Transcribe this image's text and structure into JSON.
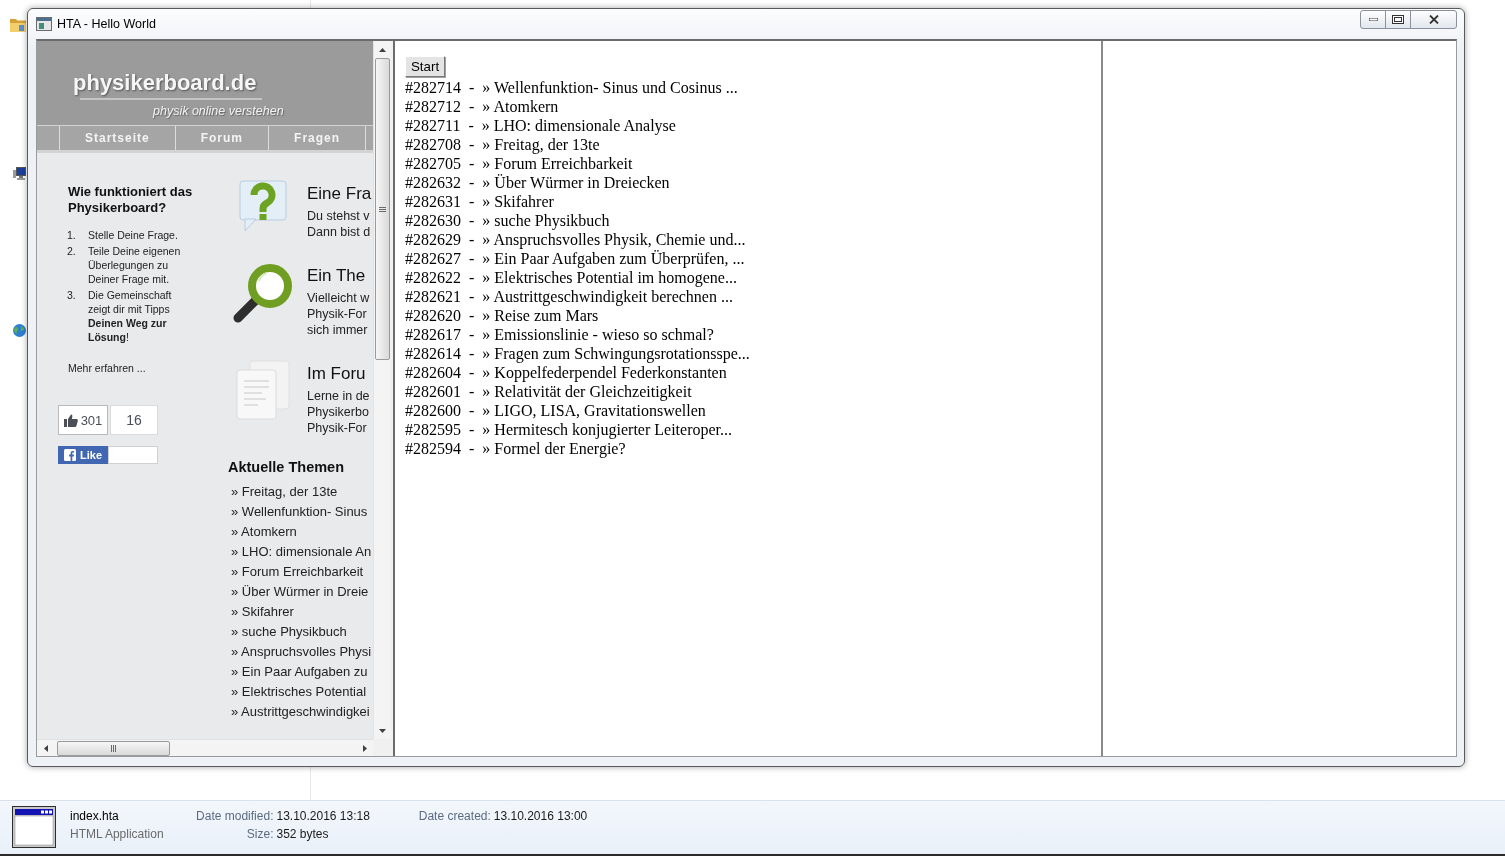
{
  "window": {
    "title": "HTA - Hello World"
  },
  "site": {
    "logo": "physikerboard.de",
    "tagline": "physik online verstehen",
    "nav": [
      "Startseite",
      "Forum",
      "Fragen"
    ],
    "intro": {
      "heading": "Wie funktioniert das Physikerboard?",
      "steps": [
        {
          "number": "1.",
          "text": "Stelle Deine Frage."
        },
        {
          "number": "2.",
          "text": "Teile Deine eigenen Überlegungen zu Deiner Frage mit."
        },
        {
          "number": "3.",
          "text": "Die Gemeinschaft zeigt dir mit Tipps **Deinen Weg zur Lösung**!"
        }
      ],
      "more_link": "Mehr erfahren ..."
    },
    "social": {
      "like_count": "301",
      "share_count": "16",
      "like_button": "Like"
    },
    "features": [
      {
        "kind": "question",
        "title": "Eine Fra",
        "lines": [
          "Du stehst v",
          "Dann bist d"
        ]
      },
      {
        "kind": "magnifier",
        "title": "Ein The",
        "lines": [
          "Vielleicht w",
          "Physik-For",
          "sich immer"
        ]
      },
      {
        "kind": "documents",
        "title": "Im Foru",
        "lines": [
          "Lerne in de",
          "Physikerbo",
          "Physik-For"
        ]
      }
    ],
    "topics": {
      "heading": "Aktuelle Themen",
      "items": [
        "» Freitag, der 13te",
        "» Wellenfunktion- Sinus",
        "» Atomkern",
        "» LHO: dimensionale An",
        "» Forum Erreichbarkeit",
        "» Über Würmer in Dreie",
        "» Skifahrer",
        "» suche Physikbuch",
        "» Anspruchsvolles Physi",
        "» Ein Paar Aufgaben zu",
        "» Elektrisches Potential",
        "» Austrittgeschwindigkei"
      ]
    }
  },
  "start_button": "Start",
  "topic_lines": [
    "#282714  -  » Wellenfunktion- Sinus und Cosinus ...",
    "#282712  -  » Atomkern",
    "#282711  -  » LHO: dimensionale Analyse",
    "#282708  -  » Freitag, der 13te",
    "#282705  -  » Forum Erreichbarkeit",
    "#282632  -  » Über Würmer in Dreiecken",
    "#282631  -  » Skifahrer",
    "#282630  -  » suche Physikbuch",
    "#282629  -  » Anspruchsvolles Physik, Chemie und...",
    "#282627  -  » Ein Paar Aufgaben zum Überprüfen, ...",
    "#282622  -  » Elektrisches Potential im homogene...",
    "#282621  -  » Austrittgeschwindigkeit berechnen ...",
    "#282620  -  » Reise zum Mars",
    "#282617  -  » Emissionslinie - wieso so schmal?",
    "#282614  -  » Fragen zum Schwingungsrotationsspe...",
    "#282604  -  » Koppelfederpendel Federkonstanten",
    "#282601  -  » Relativität der Gleichzeitigkeit",
    "#282600  -  » LIGO, LISA, Gravitationswellen",
    "#282595  -  » Hermitesch konjugierter Leiteroper...",
    "#282594  -  » Formel der Energie?"
  ],
  "file_details": {
    "name": "index.hta",
    "type": "HTML Application",
    "columns": [
      [
        {
          "label": "Date modified:",
          "value": "13.10.2016 13:18"
        },
        {
          "label": "Size:",
          "value": "352 bytes"
        }
      ],
      [
        {
          "label": "Date created:",
          "value": "13.10.2016 13:00"
        }
      ]
    ]
  }
}
